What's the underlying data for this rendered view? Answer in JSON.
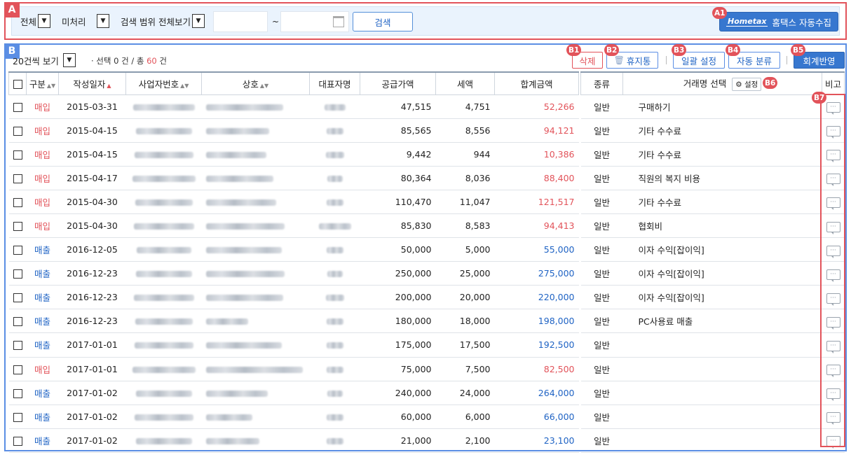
{
  "section_tags": {
    "a": "A",
    "b": "B"
  },
  "badges": {
    "a1": "A1",
    "b1": "B1",
    "b2": "B2",
    "b3": "B3",
    "b4": "B4",
    "b5": "B5",
    "b6": "B6",
    "b7": "B7"
  },
  "filters": {
    "type": "전체",
    "status": "미처리",
    "range": "검색 범위 전체보기",
    "tilde": "~",
    "search_label": "검색",
    "hometax_logo": "Hometax",
    "hometax_label": "홈택스 자동수집"
  },
  "toolbar": {
    "per_page": "20건씩 보기",
    "selected_prefix": "· 선택 0 건 / 총 ",
    "total": "60",
    "total_suffix": " 건",
    "delete": "삭제",
    "trash": "휴지통",
    "bulk": "일괄 설정",
    "auto": "자동 분류",
    "apply": "회계반영"
  },
  "columns": {
    "category": "구분",
    "date": "작성일자",
    "biz_no": "사업자번호",
    "name": "상호",
    "ceo": "대표자명",
    "supply": "공급가액",
    "tax": "세액",
    "total": "합계금액",
    "kind": "종류",
    "account": "거래명 선택",
    "setting": "설정",
    "memo": "비고"
  },
  "rows": [
    {
      "category": "매입",
      "type": "buy",
      "date": "2015-03-31",
      "supply": "47,515",
      "tax": "4,751",
      "total": "52,266",
      "kind": "일반",
      "account": "구매하기"
    },
    {
      "category": "매입",
      "type": "buy",
      "date": "2015-04-15",
      "supply": "85,565",
      "tax": "8,556",
      "total": "94,121",
      "kind": "일반",
      "account": "기타 수수료"
    },
    {
      "category": "매입",
      "type": "buy",
      "date": "2015-04-15",
      "supply": "9,442",
      "tax": "944",
      "total": "10,386",
      "kind": "일반",
      "account": "기타 수수료"
    },
    {
      "category": "매입",
      "type": "buy",
      "date": "2015-04-17",
      "supply": "80,364",
      "tax": "8,036",
      "total": "88,400",
      "kind": "일반",
      "account": "직원의 복지 비용"
    },
    {
      "category": "매입",
      "type": "buy",
      "date": "2015-04-30",
      "supply": "110,470",
      "tax": "11,047",
      "total": "121,517",
      "kind": "일반",
      "account": "기타 수수료"
    },
    {
      "category": "매입",
      "type": "buy",
      "date": "2015-04-30",
      "supply": "85,830",
      "tax": "8,583",
      "total": "94,413",
      "kind": "일반",
      "account": "협회비"
    },
    {
      "category": "매출",
      "type": "sell",
      "date": "2016-12-05",
      "supply": "50,000",
      "tax": "5,000",
      "total": "55,000",
      "kind": "일반",
      "account": "이자 수익[잡이익]"
    },
    {
      "category": "매출",
      "type": "sell",
      "date": "2016-12-23",
      "supply": "250,000",
      "tax": "25,000",
      "total": "275,000",
      "kind": "일반",
      "account": "이자 수익[잡이익]"
    },
    {
      "category": "매출",
      "type": "sell",
      "date": "2016-12-23",
      "supply": "200,000",
      "tax": "20,000",
      "total": "220,000",
      "kind": "일반",
      "account": "이자 수익[잡이익]"
    },
    {
      "category": "매출",
      "type": "sell",
      "date": "2016-12-23",
      "supply": "180,000",
      "tax": "18,000",
      "total": "198,000",
      "kind": "일반",
      "account": "PC사용료 매출"
    },
    {
      "category": "매출",
      "type": "sell",
      "date": "2017-01-01",
      "supply": "175,000",
      "tax": "17,500",
      "total": "192,500",
      "kind": "일반",
      "account": ""
    },
    {
      "category": "매입",
      "type": "buy",
      "date": "2017-01-01",
      "supply": "75,000",
      "tax": "7,500",
      "total": "82,500",
      "kind": "일반",
      "account": ""
    },
    {
      "category": "매출",
      "type": "sell",
      "date": "2017-01-02",
      "supply": "240,000",
      "tax": "24,000",
      "total": "264,000",
      "kind": "일반",
      "account": ""
    },
    {
      "category": "매출",
      "type": "sell",
      "date": "2017-01-02",
      "supply": "60,000",
      "tax": "6,000",
      "total": "66,000",
      "kind": "일반",
      "account": ""
    },
    {
      "category": "매출",
      "type": "sell",
      "date": "2017-01-02",
      "supply": "21,000",
      "tax": "2,100",
      "total": "23,100",
      "kind": "일반",
      "account": ""
    }
  ]
}
